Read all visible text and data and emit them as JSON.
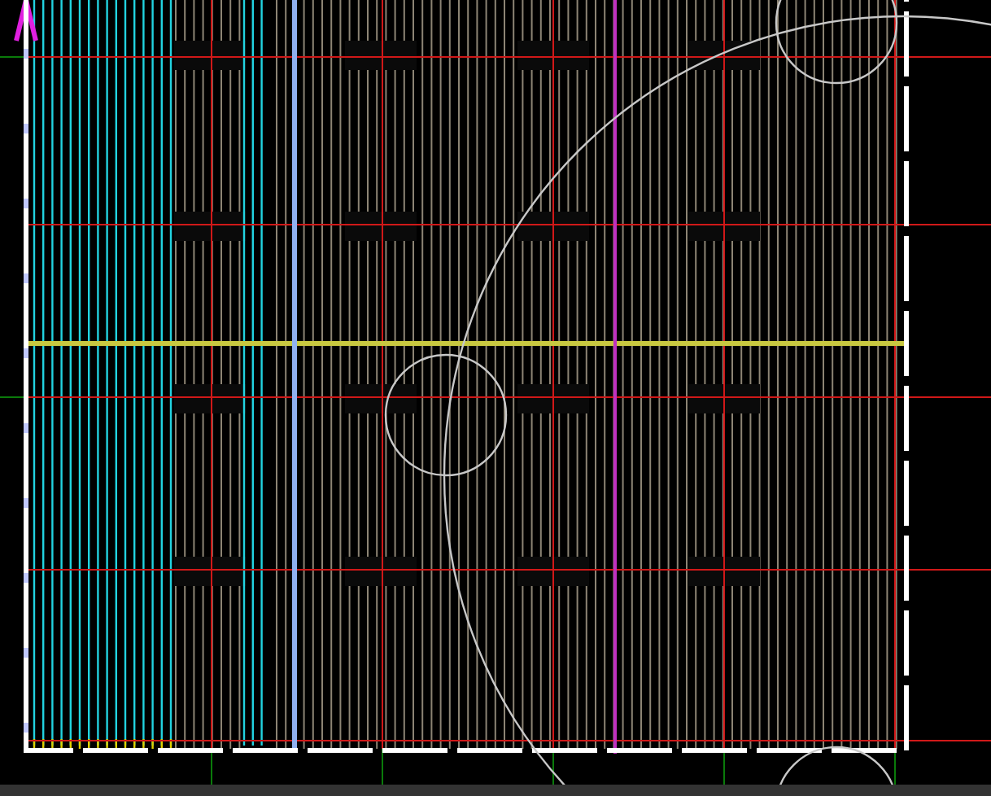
{
  "viewport": {
    "kind": "plan"
  }
}
